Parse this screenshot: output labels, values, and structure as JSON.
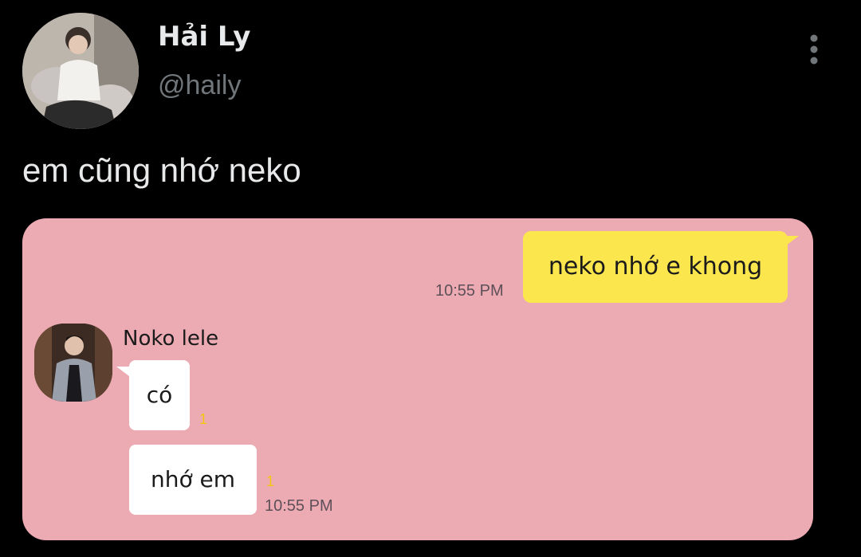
{
  "tweet": {
    "display_name": "Hải Ly",
    "handle": "@haily",
    "text": "em cũng nhớ neko",
    "more_icon": "vertical-dots-icon"
  },
  "chat": {
    "outgoing": {
      "text": "neko nhớ e khong",
      "time": "10:55 PM"
    },
    "contact_name": "Noko lele",
    "incoming": [
      {
        "text": "có",
        "unread": "1"
      },
      {
        "text": "nhớ em",
        "unread": "1",
        "time": "10:55 PM"
      }
    ]
  },
  "colors": {
    "background": "#000000",
    "chat_background": "#ecaab3",
    "outgoing_bubble": "#fbe74d",
    "incoming_bubble": "#ffffff",
    "unread_count": "#f2c511",
    "handle_text": "#71767b"
  }
}
